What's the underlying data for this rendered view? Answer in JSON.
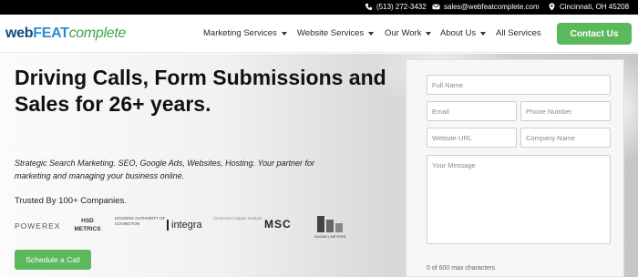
{
  "topbar": {
    "phone": "(513) 272-3432",
    "email": "sales@webfeatcomplete.com",
    "location": "Cincinnati, OH 45208"
  },
  "logo": {
    "web": "web",
    "feat": "FEAT",
    "complete": "complete"
  },
  "nav": {
    "items": [
      {
        "label": "Marketing Services",
        "has_dropdown": true
      },
      {
        "label": "Website Services",
        "has_dropdown": true
      },
      {
        "label": "Our Work",
        "has_dropdown": true
      },
      {
        "label": "About Us",
        "has_dropdown": true
      },
      {
        "label": "All Services",
        "has_dropdown": false
      }
    ],
    "contact_label": "Contact Us"
  },
  "hero": {
    "headline": "Driving Calls, Form Submissions and Sales for 26+ years.",
    "subtext": "Strategic Search Marketing. SEO, Google Ads, Websites, Hosting. Your partner for marketing and managing your business online.",
    "trusted": "Trusted By 100+ Companies.",
    "client_logos": [
      "POWEREX",
      "HSD METRICS",
      "HOUSING AUTHORITY OF COVINGTON",
      "integra",
      "Cincinnati Captain Institute",
      "MSC",
      "DUGAN | MEYERS"
    ],
    "cta_label": "Schedule a Call"
  },
  "form": {
    "full_name_placeholder": "Full Name",
    "email_placeholder": "Email",
    "phone_placeholder": "Phone Number",
    "website_placeholder": "Website URL",
    "company_placeholder": "Company Name",
    "message_placeholder": "Your Message",
    "max_chars": "0 of 600 max characters"
  },
  "colors": {
    "accent_green": "#5cb85c",
    "logo_blue": "#0f4a7a",
    "logo_light_blue": "#2a8fd0",
    "logo_green": "#3aa64a"
  }
}
